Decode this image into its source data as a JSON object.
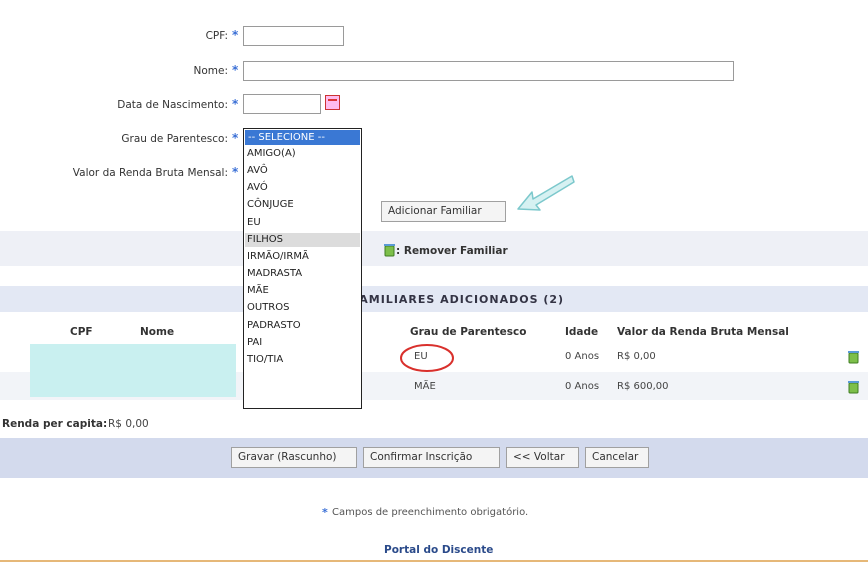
{
  "form": {
    "cpf_label": "CPF:",
    "nome_label": "Nome:",
    "nascimento_label": "Data de Nascimento:",
    "parentesco_label": "Grau de Parentesco:",
    "renda_label": "Valor da Renda Bruta Mensal:",
    "required_mark": "*",
    "cpf_value": "",
    "nome_value": "",
    "nascimento_value": ""
  },
  "dropdown": {
    "selected": "-- SELECIONE --",
    "options": [
      "AMIGO(A)",
      "AVÔ",
      "AVÓ",
      "CÔNJUGE",
      "EU",
      "FILHOS",
      "IRMÃO/IRMÃ",
      "MADRASTA",
      "MÃE",
      "OUTROS",
      "PADRASTO",
      "PAI",
      "TIO/TIA"
    ],
    "highlighted": "EU"
  },
  "buttons": {
    "adicionar": "Adicionar Familiar",
    "gravar": "Gravar (Rascunho)",
    "confirmar": "Confirmar Inscrição",
    "voltar": "<< Voltar",
    "cancelar": "Cancelar"
  },
  "legend": {
    "remover": ": Remover Familiar"
  },
  "table": {
    "title": "FAMILIARES ADICIONADOS (2)",
    "headers": {
      "cpf": "CPF",
      "nome": "Nome",
      "grau": "Grau de Parentesco",
      "idade": "Idade",
      "renda": "Valor da Renda Bruta Mensal"
    },
    "rows": [
      {
        "grau": "EU",
        "idade": "0 Anos",
        "renda": "R$ 0,00"
      },
      {
        "grau": "MÃE",
        "idade": "0 Anos",
        "renda": "R$ 600,00"
      }
    ]
  },
  "renda_per_capita": {
    "label": "Renda per capita:",
    "value": "R$ 0,00"
  },
  "footer": {
    "note": "Campos de preenchimento obrigatório.",
    "portal": "Portal do Discente"
  },
  "colors": {
    "bar": "#d3daed",
    "selected": "#3a78d4",
    "required": "#3a6fd6",
    "annotation": "#d9302c",
    "arrow": "#8fd3d6",
    "redacted": "#c9f0f0"
  }
}
